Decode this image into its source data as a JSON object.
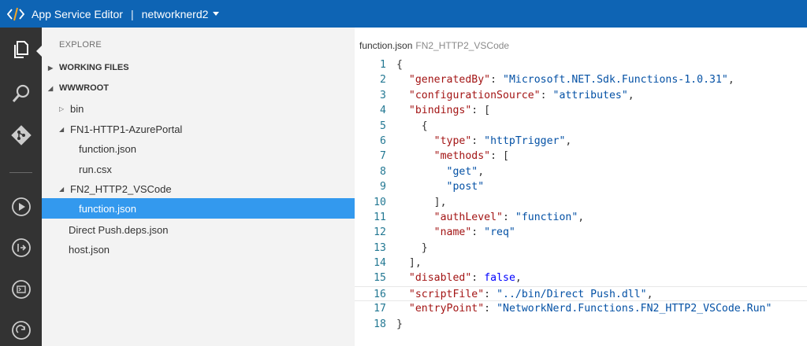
{
  "titlebar": {
    "app_title": "App Service Editor",
    "separator": "|",
    "site_name": "networknerd2"
  },
  "activitybar": {
    "items": [
      {
        "icon": "explorer-icon"
      },
      {
        "icon": "search-icon"
      },
      {
        "icon": "git-icon"
      },
      {
        "icon": "run-icon"
      },
      {
        "icon": "open-console-icon"
      },
      {
        "icon": "output-icon"
      },
      {
        "icon": "refresh-icon"
      }
    ]
  },
  "sidebar": {
    "title": "EXPLORE",
    "working_files": "WORKING FILES",
    "wwwroot": "WWWROOT",
    "items": [
      {
        "label": "bin"
      },
      {
        "label": "FN1-HTTP1-AzurePortal"
      },
      {
        "label": "function.json"
      },
      {
        "label": "run.csx"
      },
      {
        "label": "FN2_HTTP2_VSCode"
      },
      {
        "label": "function.json"
      },
      {
        "label": "Direct Push.deps.json"
      },
      {
        "label": "host.json"
      }
    ]
  },
  "editor": {
    "file": "function.json",
    "folder": "FN2_HTTP2_VSCode",
    "line_numbers": [
      "1",
      "2",
      "3",
      "4",
      "5",
      "6",
      "7",
      "8",
      "9",
      "10",
      "11",
      "12",
      "13",
      "14",
      "15",
      "16",
      "17",
      "18"
    ],
    "code": {
      "generatedBy_key": "\"generatedBy\"",
      "generatedBy_val": "\"Microsoft.NET.Sdk.Functions-1.0.31\"",
      "configurationSource_key": "\"configurationSource\"",
      "configurationSource_val": "\"attributes\"",
      "bindings_key": "\"bindings\"",
      "type_key": "\"type\"",
      "type_val": "\"httpTrigger\"",
      "methods_key": "\"methods\"",
      "get_val": "\"get\"",
      "post_val": "\"post\"",
      "authLevel_key": "\"authLevel\"",
      "authLevel_val": "\"function\"",
      "name_key": "\"name\"",
      "name_val": "\"req\"",
      "disabled_key": "\"disabled\"",
      "disabled_val": "false",
      "scriptFile_key": "\"scriptFile\"",
      "scriptFile_val": "\"../bin/Direct Push.dll\"",
      "entryPoint_key": "\"entryPoint\"",
      "entryPoint_val": "\"NetworkNerd.Functions.FN2_HTTP2_VSCode.Run\""
    }
  }
}
